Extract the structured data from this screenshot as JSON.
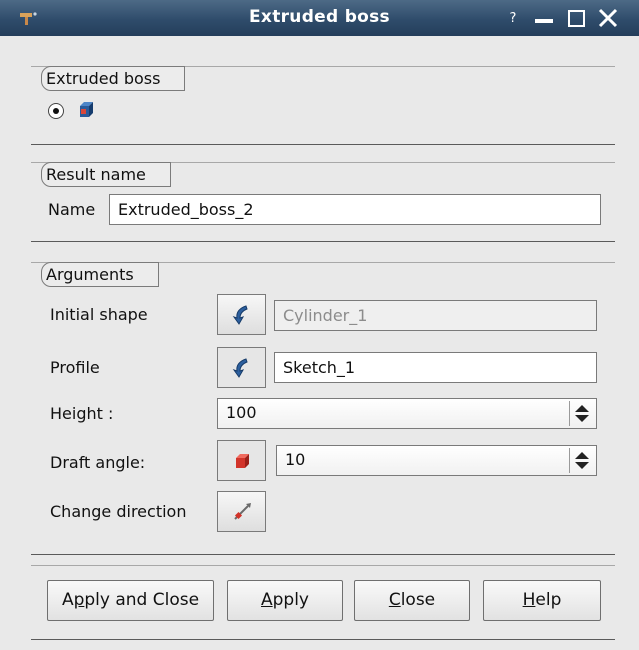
{
  "window": {
    "title": "Extruded boss",
    "help_glyph": "?",
    "colors": {
      "titlebar": "#2f4c6b",
      "background": "#e9e9e9"
    }
  },
  "extruded_boss_group": {
    "title": "Extruded boss",
    "option_icon": "extrusion-box-icon",
    "selected": true
  },
  "result_name_group": {
    "title": "Result name",
    "name_label": "Name",
    "name_value": "Extruded_boss_2"
  },
  "arguments_group": {
    "title": "Arguments",
    "initial_shape_label": "Initial shape",
    "initial_shape_value": "Cylinder_1",
    "profile_label": "Profile",
    "profile_value": "Sketch_1",
    "height_label": "Height :",
    "height_value": "100",
    "draft_angle_label": "Draft angle:",
    "draft_angle_value": "10",
    "change_direction_label": "Change direction"
  },
  "buttons": {
    "apply_and_close": {
      "before": "A",
      "mnemonic": "p",
      "after": "ply and Close"
    },
    "apply": {
      "before": "",
      "mnemonic": "A",
      "after": "pply"
    },
    "close": {
      "before": "",
      "mnemonic": "C",
      "after": "lose"
    },
    "help": {
      "before": "",
      "mnemonic": "H",
      "after": "elp"
    }
  }
}
